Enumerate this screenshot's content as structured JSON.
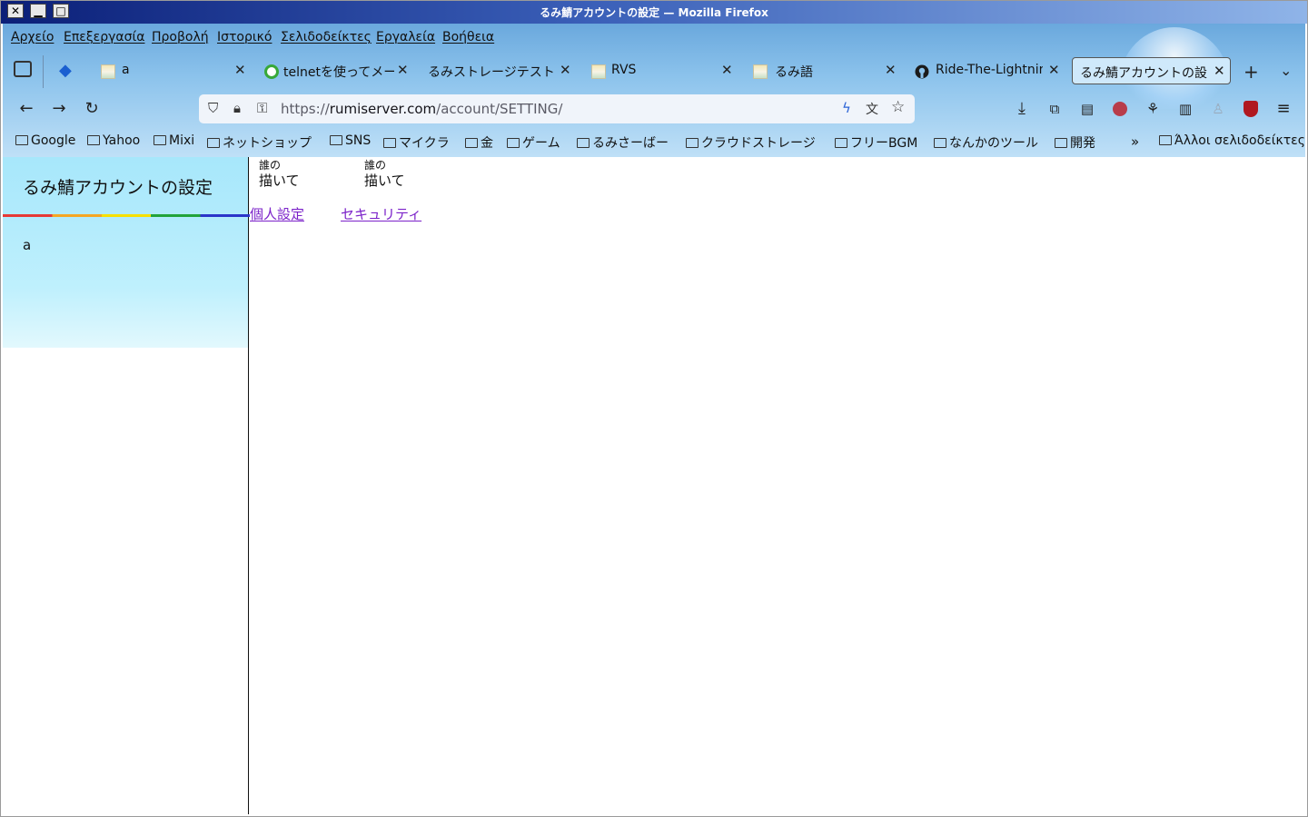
{
  "window": {
    "title": "るみ鯖アカウントの設定 — Mozilla Firefox",
    "btn_close": "✕",
    "btn_min": "▁",
    "btn_max": "□"
  },
  "menubar": [
    "Αρχείο",
    "Επεξεργασία",
    "Προβολή",
    "Ιστορικό",
    "Σελιδοδείκτες",
    "Εργαλεία",
    "Βοήθεια"
  ],
  "tabs": [
    {
      "label": "a",
      "favicon": "image-icon"
    },
    {
      "label": "telnetを使ってメー",
      "favicon": "green-circle-icon"
    },
    {
      "label": "るみストレージテスト",
      "favicon": "none"
    },
    {
      "label": "RVS",
      "favicon": "image-icon"
    },
    {
      "label": "るみ語",
      "favicon": "image-icon"
    },
    {
      "label": "Ride-The-Lightnin",
      "favicon": "github-icon"
    },
    {
      "label": "るみ鯖アカウントの設",
      "favicon": "none",
      "active": true
    }
  ],
  "url": {
    "prefix": "https://",
    "host": "rumiserver.com",
    "path": "/account/SETTING/"
  },
  "bookmarks": [
    "Google",
    "Yahoo",
    "Mixi",
    "ネットショップ",
    "SNS",
    "マイクラ",
    "金",
    "ゲーム",
    "るみさーばー",
    "クラウドストレージ",
    "フリーBGM",
    "なんかのツール",
    "開発"
  ],
  "other_bookmarks": "Άλλοι σελιδοδείκτες",
  "sidebar": {
    "title": "るみ鯖アカウントの設定",
    "item": "a"
  },
  "main": {
    "tiles": [
      {
        "small": "誰の",
        "big": "描いて"
      },
      {
        "small": "誰の",
        "big": "描いて"
      }
    ],
    "links": [
      "個人設定",
      "セキュリティ"
    ]
  }
}
